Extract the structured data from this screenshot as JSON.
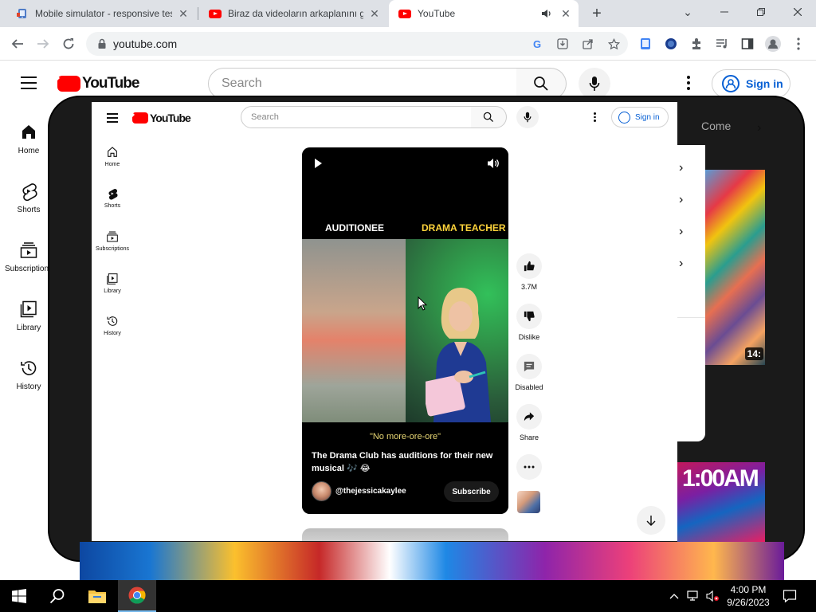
{
  "browser": {
    "tabs": [
      {
        "title": "Mobile simulator - responsive testing",
        "active": false
      },
      {
        "title": "Biraz da videoların arkaplanını göster",
        "active": false
      },
      {
        "title": "YouTube",
        "active": true
      }
    ],
    "url": "youtube.com"
  },
  "youtube": {
    "logo_text": "YouTube",
    "search_placeholder": "Search",
    "signin_label": "Sign in",
    "sidebar": [
      {
        "label": "Home",
        "icon": "home-icon"
      },
      {
        "label": "Shorts",
        "icon": "shorts-icon"
      },
      {
        "label": "Subscriptions",
        "icon": "subscriptions-icon"
      },
      {
        "label": "Library",
        "icon": "library-icon"
      },
      {
        "label": "History",
        "icon": "history-icon"
      }
    ],
    "chip_partial": "Come",
    "thumb_duration": "14:",
    "thumb2_text": "1:00AM"
  },
  "mobile": {
    "logo_text": "YouTube",
    "search_placeholder": "Search",
    "signin_label": "Sign in",
    "sidebar": [
      {
        "label": "Home"
      },
      {
        "label": "Shorts"
      },
      {
        "label": "Subscriptions"
      },
      {
        "label": "Library"
      },
      {
        "label": "History"
      }
    ],
    "short": {
      "label_left": "AUDITIONEE",
      "label_right": "DRAMA TEACHER",
      "quote": "\"No more-ore-ore\"",
      "caption": "The Drama Club has auditions for their new musical 🎶 😂",
      "channel": "@thejessicakaylee",
      "subscribe_label": "Subscribe"
    },
    "actions": {
      "likes": "3.7M",
      "dislike": "Dislike",
      "comments": "Disabled",
      "share": "Share"
    }
  },
  "taskbar": {
    "time": "4:00 PM",
    "date": "9/26/2023"
  },
  "colors": {
    "yt_red": "#ff0000",
    "link_blue": "#065fd4",
    "drama_teacher_yellow": "#ffd43b"
  }
}
